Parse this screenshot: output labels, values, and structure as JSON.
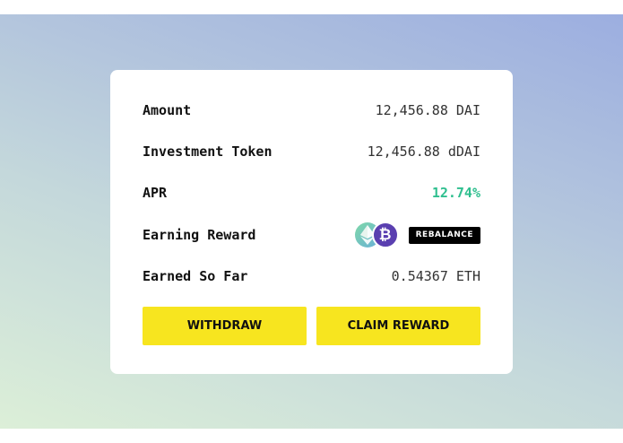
{
  "rows": {
    "amount": {
      "label": "Amount",
      "value": "12,456.88 DAI"
    },
    "investment_token": {
      "label": "Investment Token",
      "value": "12,456.88 dDAI"
    },
    "apr": {
      "label": "APR",
      "value": "12.74%"
    },
    "earning_reward": {
      "label": "Earning Reward",
      "icons": [
        "ethereum-icon",
        "bitcoin-icon"
      ],
      "btc_glyph": "₿",
      "badge": "REBALANCE"
    },
    "earned_so_far": {
      "label": "Earned So Far",
      "value": "0.54367 ETH"
    }
  },
  "actions": {
    "withdraw": "WITHDRAW",
    "claim_reward": "CLAIM REWARD"
  },
  "colors": {
    "accent_button": "#f7e51f",
    "apr_green": "#2fbf8f",
    "btc_purple": "#5a3fb0"
  }
}
